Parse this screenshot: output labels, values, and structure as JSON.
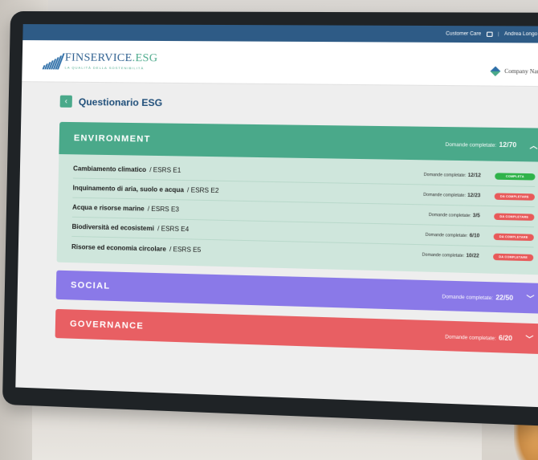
{
  "topbar": {
    "customer_care": "Customer Care",
    "user": "Andrea Longo"
  },
  "logo": {
    "main": "FINSERVICE",
    "suffix": ".ESG",
    "tagline": "LA QUALITÀ DELLA SOSTENIBILITÀ"
  },
  "company_name": "Company Name",
  "page_title": "Questionario ESG",
  "sections": {
    "environment": {
      "name": "ENVIRONMENT",
      "count_label": "Domande completate:",
      "done": "12",
      "total": "/70",
      "rows": [
        {
          "name": "Cambiamento climatico",
          "code": "/  ESRS E1",
          "count_label": "Domande completate:",
          "done": "12",
          "total": "/12",
          "status": "COMPLETA"
        },
        {
          "name": "Inquinamento di aria, suolo e acqua",
          "code": "/  ESRS E2",
          "count_label": "Domande completate:",
          "done": "12",
          "total": "/23",
          "status": "DA COMPLETARE"
        },
        {
          "name": "Acqua e risorse marine",
          "code": "/  ESRS E3",
          "count_label": "Domande completate:",
          "done": "3",
          "total": "/5",
          "status": "DA COMPLETARE"
        },
        {
          "name": "Biodiversità ed ecosistemi",
          "code": "/  ESRS E4",
          "count_label": "Domande completate:",
          "done": "6",
          "total": "/10",
          "status": "DA COMPLETARE"
        },
        {
          "name": "Risorse ed economia circolare",
          "code": "/  ESRS E5",
          "count_label": "Domande completate:",
          "done": "10",
          "total": "/22",
          "status": "DA COMPLETARE"
        }
      ]
    },
    "social": {
      "name": "SOCIAL",
      "count_label": "Domande completate:",
      "done": "22",
      "total": "/50"
    },
    "governance": {
      "name": "GOVERNANCE",
      "count_label": "Domande completate:",
      "done": "6",
      "total": "/20"
    }
  },
  "colors": {
    "environment": "#4aa98a",
    "social": "#8a79e8",
    "governance": "#e85f63",
    "topbar": "#2e5b86"
  }
}
